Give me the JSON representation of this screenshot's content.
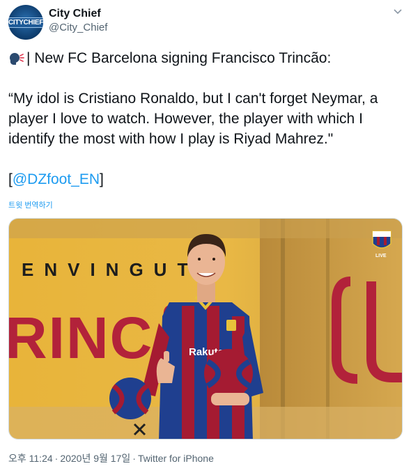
{
  "author": {
    "display_name": "City Chief",
    "handle": "@City_Chief",
    "avatar_text": "CITYCHIEF"
  },
  "tweet": {
    "emoji_icon": "speaking-head-icon",
    "line1": "| New FC Barcelona signing Francisco Trincão:",
    "quote": "“My idol is Cristiano Ronaldo, but I can't forget Neymar, a player I love to watch. However, the player with which I identify the most with how I play is Riyad Mahrez.\"",
    "mention_open": "[",
    "mention": "@DZfoot_EN",
    "mention_close": "]",
    "translate_label": "트윗 번역하기"
  },
  "photo": {
    "banner_text": "ENVINGUT",
    "big_text": "RINCÃ",
    "sponsor": "Rakuten",
    "badge": "LIVE"
  },
  "meta": {
    "time": "오후 11:24",
    "date": "2020년 9월 17일",
    "separator": "·",
    "source": "Twitter for iPhone"
  },
  "colors": {
    "link": "#1d9bf0",
    "secondary_text": "#536471",
    "barca_blue": "#1f3f8f",
    "barca_red": "#a51b32"
  }
}
